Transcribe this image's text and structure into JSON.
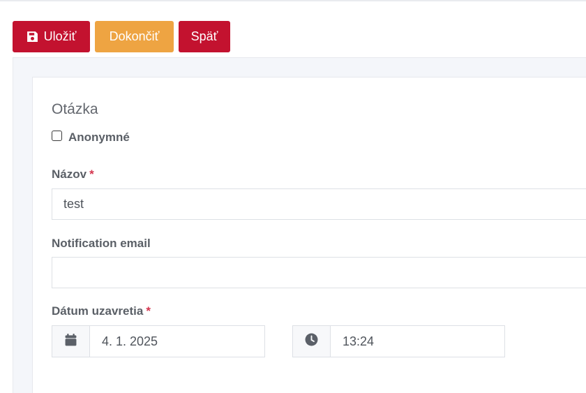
{
  "toolbar": {
    "save_label": "Uložiť",
    "finish_label": "Dokončiť",
    "back_label": "Späť",
    "save_icon": "floppy-disk-icon"
  },
  "form": {
    "section_title": "Otázka",
    "anonymous": {
      "label": "Anonymné",
      "checked": false
    },
    "name": {
      "label": "Názov",
      "required_mark": "*",
      "value": "test"
    },
    "notification_email": {
      "label": "Notification email",
      "value": ""
    },
    "closing_date": {
      "label": "Dátum uzavretia",
      "required_mark": "*",
      "date_value": "4. 1. 2025",
      "time_value": "13:24",
      "date_icon": "calendar-icon",
      "time_icon": "clock-icon"
    }
  },
  "colors": {
    "primary": "#c3122f",
    "warning": "#eea442",
    "required": "#d4354e",
    "panel_bg": "#f4f6fa"
  }
}
